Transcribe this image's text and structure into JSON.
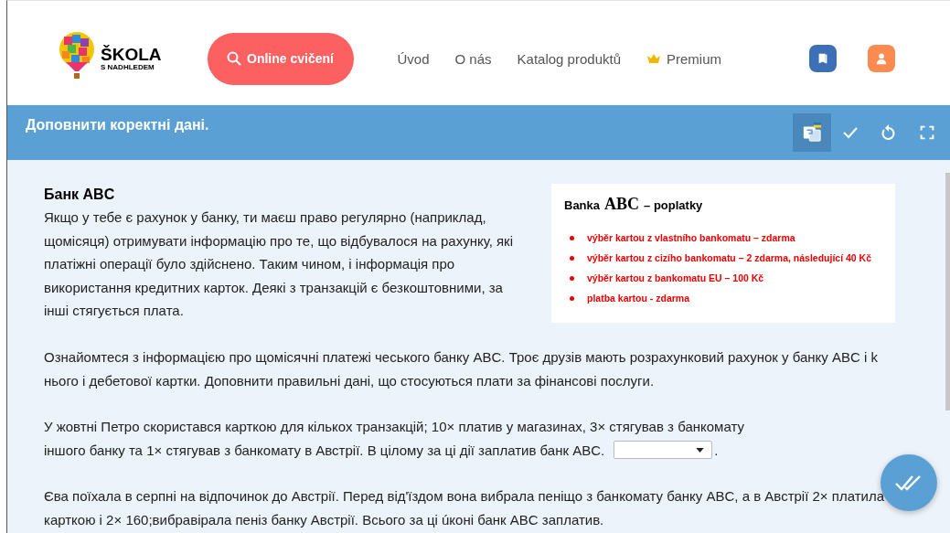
{
  "header": {
    "logo": {
      "line1": "ŠKOLA",
      "line2": "S NADHLEDEM"
    },
    "search_button": "Online cvičení",
    "nav": [
      {
        "label": "Úvod",
        "kind": "text"
      },
      {
        "label": "O nás",
        "kind": "text"
      },
      {
        "label": "Katalog produktů",
        "kind": "text"
      },
      {
        "label": "Premium",
        "kind": "crown"
      }
    ]
  },
  "toolbar": {
    "title": "Доповнити коректні дані.",
    "translate_selected": true
  },
  "content": {
    "heading": "Банк ABC",
    "intro": "Якщо у тебе є рахунок у банку, ти маєш право регулярно (наприклад, щомісяця) отримувати інформацію про те, що відбувалося на рахунку, які платіжні операції було здійснено. Таким чином, і інформація про використання кредитних карток. Деякі з транзакцій  є безкоштовними, за інші стягується плата.",
    "fee_card": {
      "title_before": "Banka",
      "title_brand": "ABC",
      "title_after": "– poplatky",
      "items": [
        "výběr kartou z vlastního bankomatu – zdarma",
        "výběr kartou z cizího bankomatu – 2 zdarma, následující 40 Kč",
        "výběr kartou z bankomatu EU – 100 Kč",
        "platba kartou - zdarma"
      ]
    },
    "paragraphs": [
      {
        "text": "Ознайомтеся з інформацією про щомісячні платежі чеського банку ABC. Троє друзів мають розрахунковий рахунок у банку ABC і k нього і дебетової картки. Доповнити правильні дані, що стосуються плати за фінансові послуги."
      },
      {
        "text": "У жовтні Петро скористався карткою для кількох транзакцій; 10× платив у магазинах, 3× стягував з банкомату",
        "text_line2": "іншого банку та 1× стягував з банкомату в Австрії. В цілому за ці дії заплатив банк ABC.",
        "after": "."
      },
      {
        "text": "Єва поїхала в серпні на відпочинок до Австрії. Перед від'їздом вона вибрала пеніщо з банкомату банку ABC, а в Австрії 2× платила карткою і 2× 160;вибравірала пеніз банку Австрії. Всього за ці úконі банк ABC заплатив."
      }
    ]
  }
}
